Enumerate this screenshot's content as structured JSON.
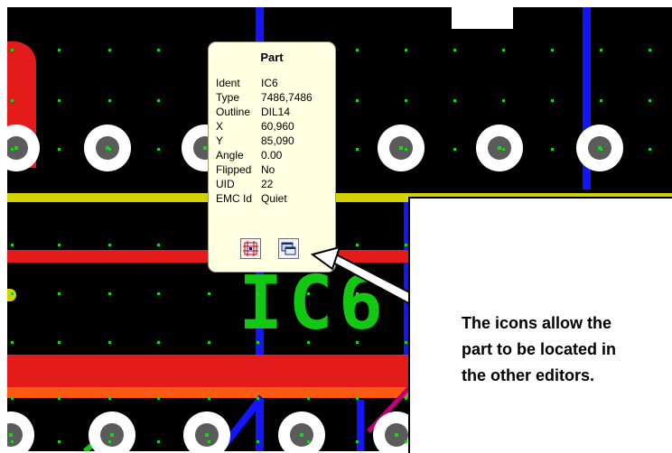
{
  "popup": {
    "title": "Part",
    "rows": [
      {
        "label": "Ident",
        "value": "IC6"
      },
      {
        "label": "Type",
        "value": "7486,7486"
      },
      {
        "label": "Outline",
        "value": "DIL14"
      },
      {
        "label": "X",
        "value": "60,960"
      },
      {
        "label": "Y",
        "value": "85,090"
      },
      {
        "label": "Angle",
        "value": "0.00"
      },
      {
        "label": "Flipped",
        "value": "No"
      },
      {
        "label": "UID",
        "value": "22"
      },
      {
        "label": "EMC Id",
        "value": "Quiet"
      }
    ],
    "buttons": [
      {
        "name": "locate-in-schematic-icon"
      },
      {
        "name": "locate-in-other-editor-icon"
      }
    ]
  },
  "board": {
    "silkscreen_label": "IC6",
    "colors": {
      "background": "#000000",
      "copper_red": "#e31b1b",
      "copper_orange": "#ff5a14",
      "track_yellow": "#d2d200",
      "track_blue": "#1414ff",
      "silkscreen_green": "#12c812",
      "grid_dot": "#1fd11f",
      "pad_ring": "#ffffff",
      "pad_hole": "#5b5b5b"
    }
  },
  "callout": {
    "lines": [
      "The icons allow the",
      "part to be located in",
      "the other editors."
    ]
  }
}
